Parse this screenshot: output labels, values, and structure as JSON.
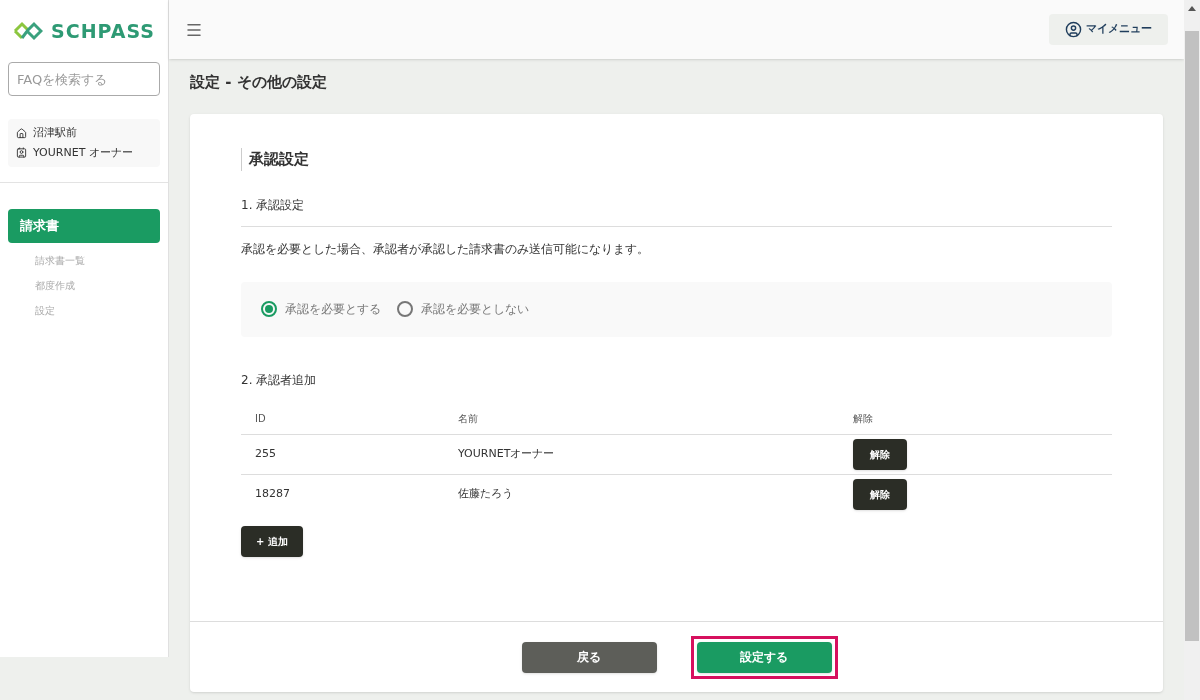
{
  "logo": {
    "text": "SCHPASS"
  },
  "search": {
    "placeholder": "FAQを検索する"
  },
  "account": {
    "school": "沼津駅前",
    "user": "YOURNET オーナー"
  },
  "nav": [
    {
      "label": "請求書",
      "selected": true,
      "children": [
        {
          "label": "請求書一覧"
        },
        {
          "label": "都度作成"
        },
        {
          "label": "設定"
        }
      ]
    }
  ],
  "header": {
    "my_menu": "マイメニュー"
  },
  "page_title": "設定 - その他の設定",
  "card": {
    "title": "承認設定",
    "section1": {
      "heading": "1. 承認設定",
      "description": "承認を必要とした場合、承認者が承認した請求書のみ送信可能になります。",
      "options": [
        {
          "label": "承認を必要とする",
          "selected": true
        },
        {
          "label": "承認を必要としない",
          "selected": false
        }
      ]
    },
    "section2": {
      "heading": "2. 承認者追加",
      "columns": [
        "ID",
        "名前",
        "解除"
      ],
      "rows": [
        {
          "id": "255",
          "name": "YOURNETオーナー",
          "action": "解除"
        },
        {
          "id": "18287",
          "name": "佐藤たろう",
          "action": "解除"
        }
      ],
      "add_button": "+ 追加"
    },
    "footer": [
      {
        "label": "戻る",
        "kind": "secondary",
        "highlighted": false
      },
      {
        "label": "設定する",
        "kind": "primary",
        "highlighted": true
      }
    ]
  }
}
